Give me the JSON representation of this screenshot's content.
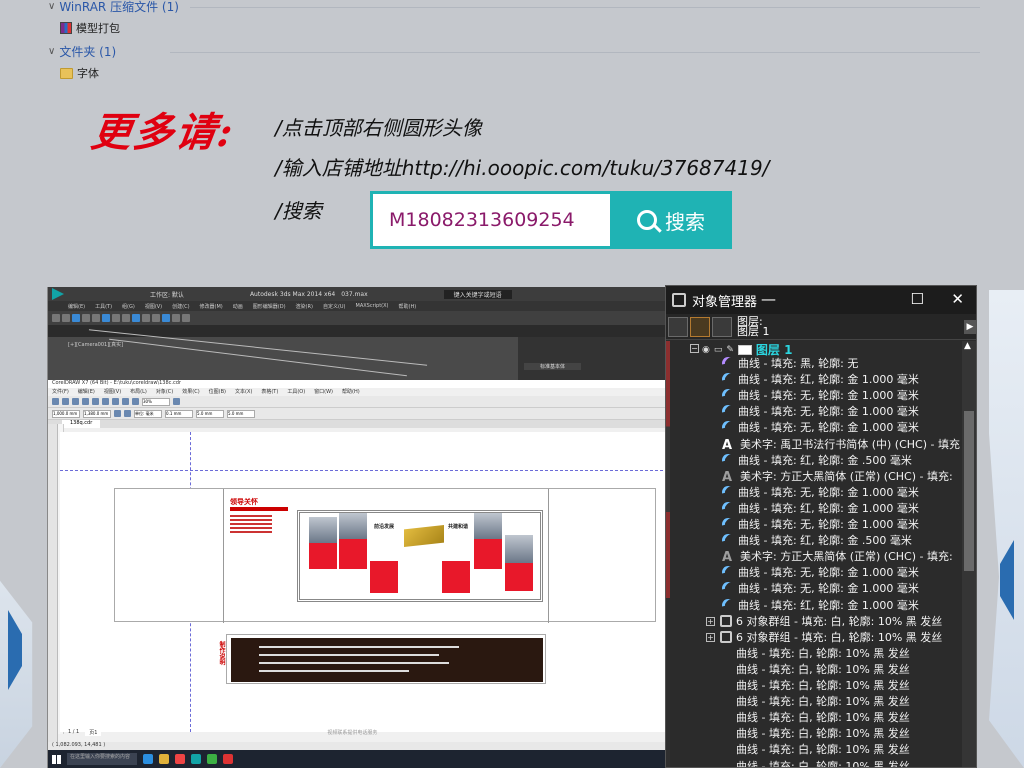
{
  "explorer": {
    "group1": "WinRAR 压缩文件 (1)",
    "file1": "模型打包",
    "group2": "文件夹 (1)",
    "file2": "字体"
  },
  "promo": {
    "heading": "更多请:",
    "line1": "/点击顶部右侧圆形头像",
    "line2": "/输入店铺地址http://hi.ooopic.com/tuku/37687419/",
    "line3": "/搜索",
    "search_value": "M18082313609254",
    "search_button": "搜索"
  },
  "max": {
    "title": "Autodesk 3ds Max 2014 x64",
    "file": "037.max",
    "workspace": "工作区: 默认",
    "search_placeholder": "键入关键字或短语",
    "menu": [
      "编辑(E)",
      "工具(T)",
      "组(G)",
      "视图(V)",
      "创建(C)",
      "修改器(M)",
      "动画",
      "图形编辑器(D)",
      "渲染(R)",
      "自定义(U)",
      "MAXScript(X)",
      "帮助(H)"
    ],
    "viewport_label": "[+][Camera001][真实]",
    "cmd_label": "标准基本体"
  },
  "cdr": {
    "title": "CorelDRAW X7 (64 Bit) - E:\\tuku\\coreldraw\\138c.cdr",
    "menu": [
      "文件(F)",
      "编辑(E)",
      "视图(V)",
      "布局(L)",
      "对象(C)",
      "效果(C)",
      "位图(B)",
      "文本(X)",
      "表格(T)",
      "工具(O)",
      "窗口(W)",
      "帮助(H)"
    ],
    "doc_tab": "138q.cdr",
    "zoom": "30%",
    "unit": "单位: 毫米",
    "size_w": "1,000.0 mm",
    "size_h": "1,380.0 mm",
    "nudge": "0.1 mm",
    "dup1": "5.0 mm",
    "dup2": "5.0 mm",
    "page_tab": "页1",
    "page_count": "1 / 1",
    "status_coords": "( 1,082.093, 14,481 )",
    "panel_heading": "领导关怀",
    "panel_label1": "前沿发展",
    "panel_label2": "共建和谐",
    "make_note": "制作说明",
    "footer_note": "视频联系提供电话服务"
  },
  "taskbar": {
    "search_placeholder": "在这里输入你要搜索的内容"
  },
  "objmgr": {
    "title": "对象管理器",
    "page_label": "图层:",
    "page_label2": "图层 1",
    "layer": "图层 1",
    "rows": [
      {
        "icon": "curve-p",
        "text": "曲线 - 填充: 黑, 轮廓: 无"
      },
      {
        "icon": "curve",
        "text": "曲线 - 填充: 红, 轮廓: 金 1.000 毫米"
      },
      {
        "icon": "curve",
        "text": "曲线 - 填充: 无, 轮廓: 金 1.000 毫米"
      },
      {
        "icon": "curve",
        "text": "曲线 - 填充: 无, 轮廓: 金 1.000 毫米"
      },
      {
        "icon": "curve",
        "text": "曲线 - 填充: 无, 轮廓: 金 1.000 毫米"
      },
      {
        "icon": "text",
        "text": "美术字: 禹卫书法行书简体 (中) (CHC) - 填充"
      },
      {
        "icon": "curve",
        "text": "曲线 - 填充: 红, 轮廓: 金 .500 毫米"
      },
      {
        "icon": "text-g",
        "text": "美术字: 方正大黑简体 (正常) (CHC) - 填充:"
      },
      {
        "icon": "curve",
        "text": "曲线 - 填充: 无, 轮廓: 金 1.000 毫米"
      },
      {
        "icon": "curve",
        "text": "曲线 - 填充: 红, 轮廓: 金 1.000 毫米"
      },
      {
        "icon": "curve",
        "text": "曲线 - 填充: 无, 轮廓: 金 1.000 毫米"
      },
      {
        "icon": "curve",
        "text": "曲线 - 填充: 红, 轮廓: 金 .500 毫米"
      },
      {
        "icon": "text-g",
        "text": "美术字: 方正大黑简体 (正常) (CHC) - 填充:"
      },
      {
        "icon": "curve",
        "text": "曲线 - 填充: 无, 轮廓: 金 1.000 毫米"
      },
      {
        "icon": "curve",
        "text": "曲线 - 填充: 无, 轮廓: 金 1.000 毫米"
      },
      {
        "icon": "curve",
        "text": "曲线 - 填充: 红, 轮廓: 金 1.000 毫米"
      },
      {
        "icon": "group",
        "text": "6 对象群组 - 填充: 白, 轮廓: 10% 黑 发丝"
      },
      {
        "icon": "group",
        "text": "6 对象群组 - 填充: 白, 轮廓: 10% 黑 发丝"
      },
      {
        "icon": "none",
        "text": "曲线 - 填充: 白, 轮廓: 10% 黑 发丝"
      },
      {
        "icon": "none",
        "text": "曲线 - 填充: 白, 轮廓: 10% 黑 发丝"
      },
      {
        "icon": "none",
        "text": "曲线 - 填充: 白, 轮廓: 10% 黑 发丝"
      },
      {
        "icon": "none",
        "text": "曲线 - 填充: 白, 轮廓: 10% 黑 发丝"
      },
      {
        "icon": "none",
        "text": "曲线 - 填充: 白, 轮廓: 10% 黑 发丝"
      },
      {
        "icon": "none",
        "text": "曲线 - 填充: 白, 轮廓: 10% 黑 发丝"
      },
      {
        "icon": "none",
        "text": "曲线 - 填充: 白, 轮廓: 10% 黑 发丝"
      },
      {
        "icon": "none",
        "text": "曲线 - 填充: 白, 轮廓: 10% 黑 发丝"
      }
    ]
  },
  "colors": {
    "accent": "#1fb3b4",
    "promo_red": "#e00010",
    "layer_cyan": "#2bd6e0"
  }
}
